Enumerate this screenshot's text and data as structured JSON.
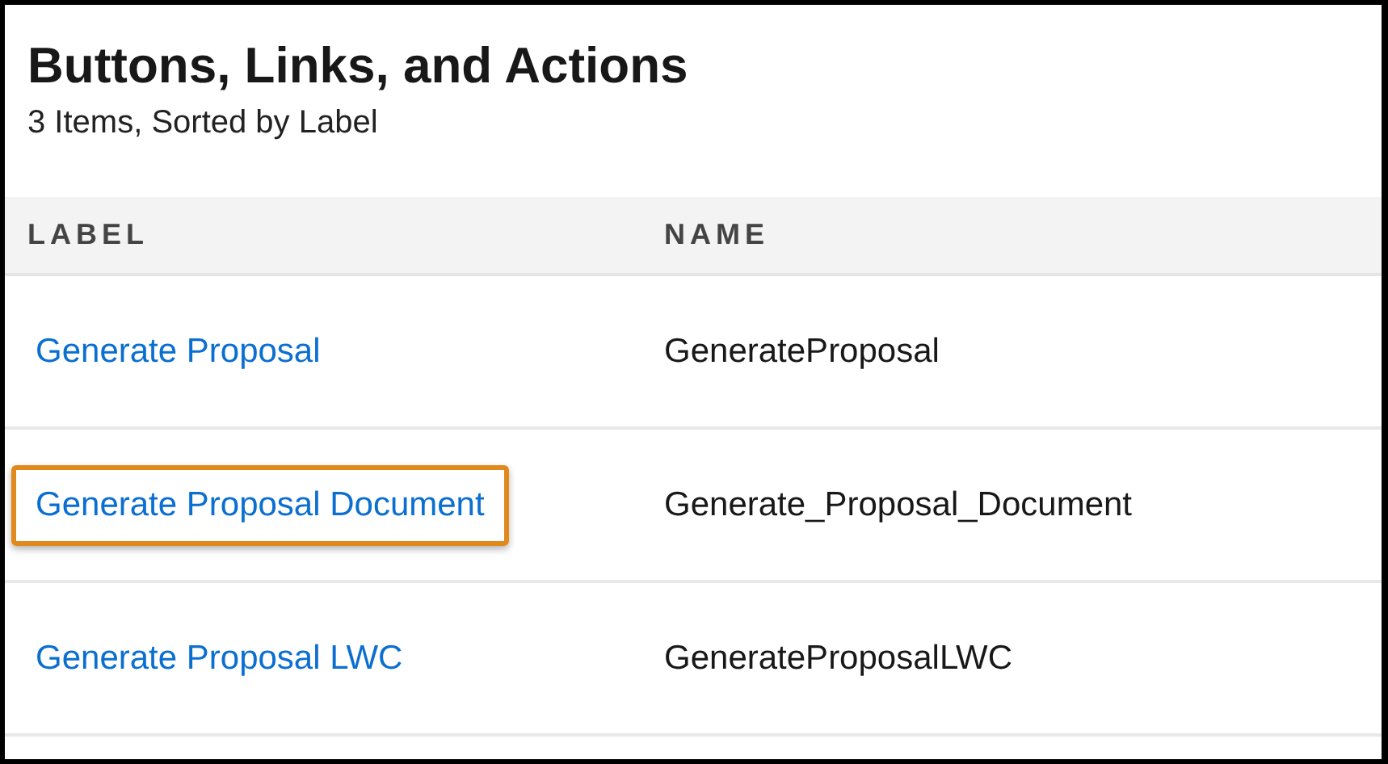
{
  "header": {
    "title": "Buttons, Links, and Actions",
    "subtitle": "3 Items, Sorted by Label"
  },
  "table": {
    "columns": [
      "LABEL",
      "NAME"
    ],
    "rows": [
      {
        "label": "Generate Proposal",
        "name": "GenerateProposal",
        "highlighted": false
      },
      {
        "label": "Generate Proposal Document",
        "name": "Generate_Proposal_Document",
        "highlighted": true
      },
      {
        "label": "Generate Proposal LWC",
        "name": "GenerateProposalLWC",
        "highlighted": false
      }
    ]
  }
}
